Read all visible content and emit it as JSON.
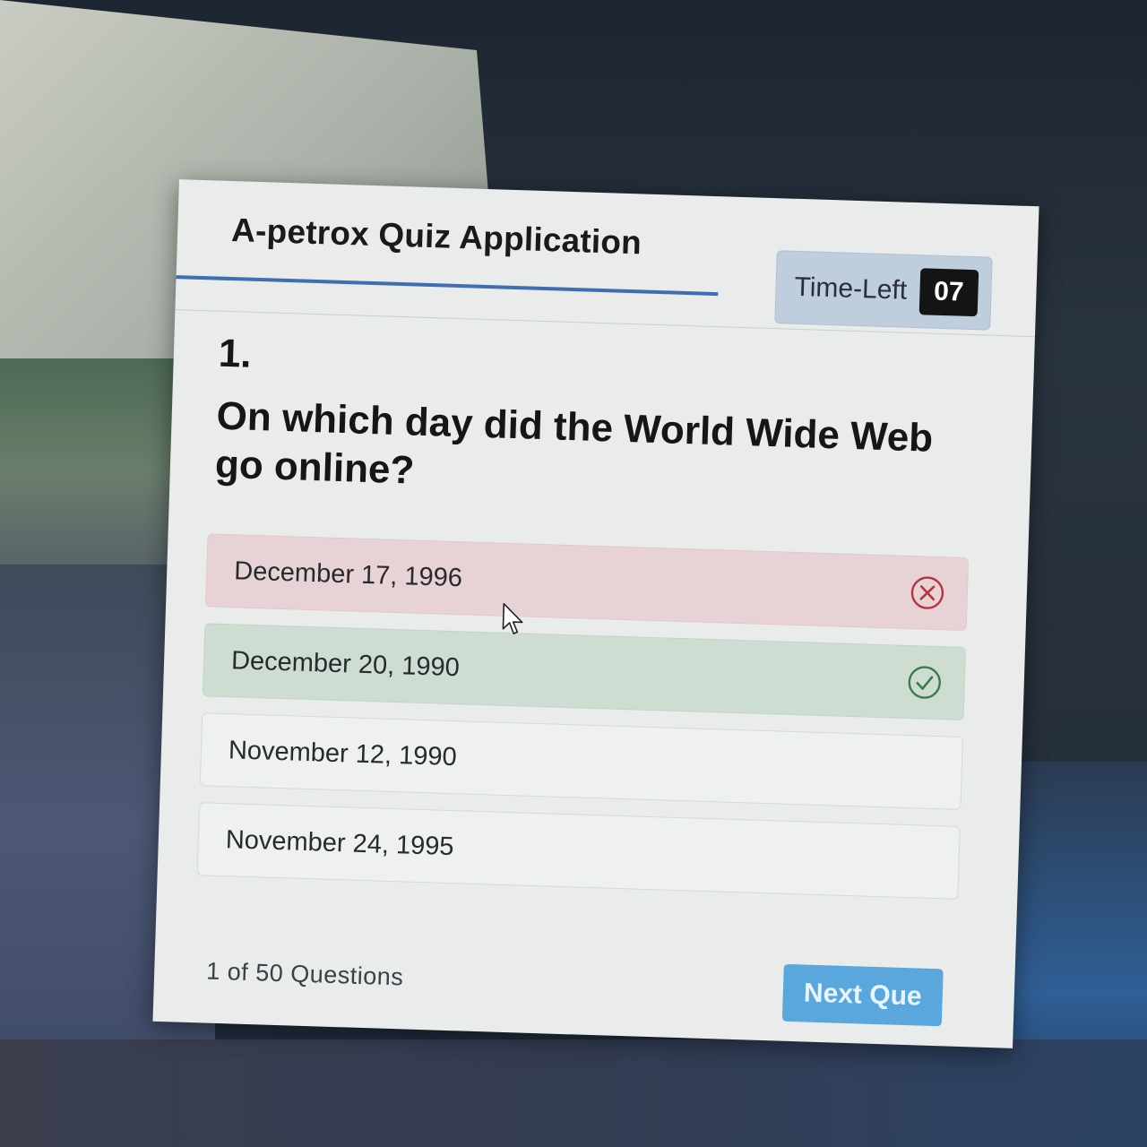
{
  "app": {
    "title": "A-petrox Quiz Application"
  },
  "timer": {
    "label": "Time-Left",
    "seconds": "07"
  },
  "question": {
    "number": "1.",
    "text": "On which day did the World Wide Web go online?"
  },
  "options": [
    {
      "label": "December 17, 1996",
      "state": "incorrect",
      "icon": "x-circle-icon"
    },
    {
      "label": "December 20, 1990",
      "state": "correct",
      "icon": "check-circle-icon"
    },
    {
      "label": "November 12, 1990",
      "state": "unanswered"
    },
    {
      "label": "November 24, 1995",
      "state": "unanswered"
    }
  ],
  "footer": {
    "question_count": "1 of 50 Questions",
    "next_button_label": "Next Que"
  },
  "colors": {
    "accent": "#3f6fb3",
    "incorrect": "#e7d3d6",
    "correct": "#cdddd2",
    "button": "#5aa7de"
  }
}
